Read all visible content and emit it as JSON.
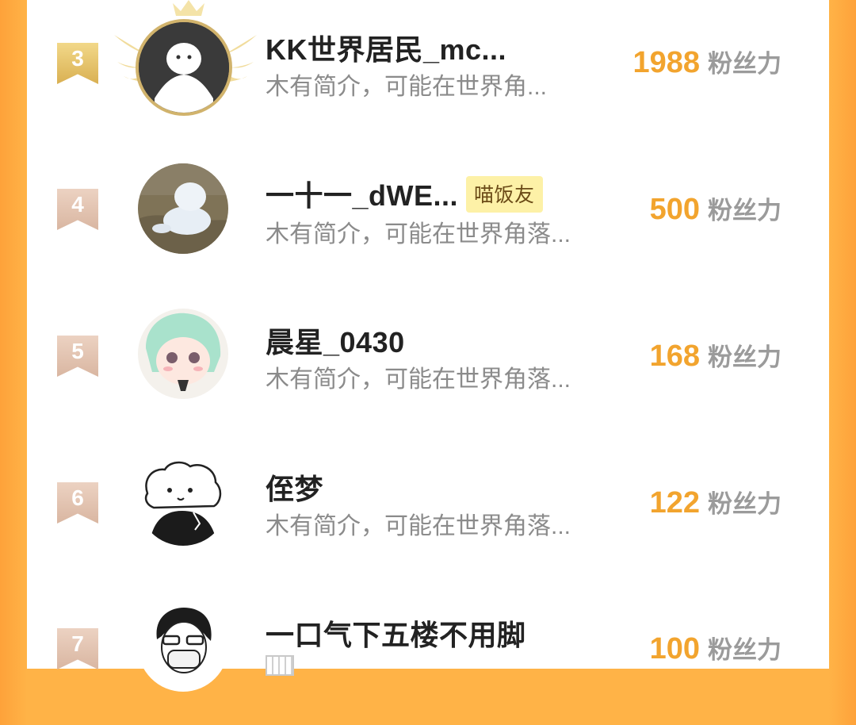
{
  "units_label": "粉丝力",
  "rows": [
    {
      "rank": "3",
      "name": "KK世界居民_mc...",
      "badge": "",
      "bio": "木有简介，可能在世界角...",
      "score": "1988",
      "avatar": "ghost-avatar"
    },
    {
      "rank": "4",
      "name": "一十一_dWE...",
      "badge": "喵饭友",
      "bio": "木有简介，可能在世界角落...",
      "score": "500",
      "avatar": "snowman-avatar"
    },
    {
      "rank": "5",
      "name": "晨星_0430",
      "badge": "",
      "bio": "木有简介，可能在世界角落...",
      "score": "168",
      "avatar": "anime-girl-avatar"
    },
    {
      "rank": "6",
      "name": "侄梦",
      "badge": "",
      "bio": "木有简介，可能在世界角落...",
      "score": "122",
      "avatar": "bear-avatar"
    },
    {
      "rank": "7",
      "name": "一口气下五楼不用脚",
      "badge": "",
      "bio": "",
      "score": "100",
      "avatar": "masked-boy-avatar"
    }
  ],
  "colors": {
    "accent_orange": "#ffb347",
    "score_color": "#f2a42e",
    "badge_bg": "#fdf1a7"
  }
}
